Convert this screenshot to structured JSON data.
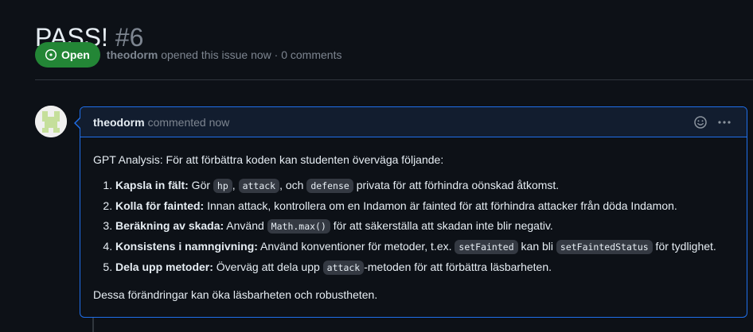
{
  "issue": {
    "title": "PASS!",
    "number": "#6",
    "state": "Open",
    "author": "theodorm",
    "opened_text": "opened this issue now · 0 comments"
  },
  "comment": {
    "author": "theodorm",
    "action": "commented now",
    "intro": "GPT Analysis: För att förbättra koden kan studenten överväga följande:",
    "items": [
      {
        "title": "Kapsla in fält:",
        "parts": [
          " Gör ",
          "hp",
          ", ",
          "attack",
          ", och ",
          "defense",
          " privata för att förhindra oönskad åtkomst."
        ]
      },
      {
        "title": "Kolla för fainted:",
        "parts": [
          " Innan attack, kontrollera om en Indamon är fainted för att förhindra attacker från döda Indamon."
        ]
      },
      {
        "title": "Beräkning av skada:",
        "parts": [
          " Använd ",
          "Math.max()",
          " för att säkerställa att skadan inte blir negativ."
        ]
      },
      {
        "title": "Konsistens i namngivning:",
        "parts": [
          " Använd konventioner för metoder, t.ex. ",
          "setFainted",
          " kan bli ",
          "setFaintedStatus",
          " för tydlighet."
        ]
      },
      {
        "title": "Dela upp metoder:",
        "parts": [
          " Överväg att dela upp ",
          "attack",
          "-metoden för att förbättra läsbarheten."
        ]
      }
    ],
    "outro": "Dessa förändringar kan öka läsbarheten och robustheten."
  },
  "icons": {
    "state": "issue-opened-icon",
    "reaction": "smiley-icon",
    "menu": "kebab-horizontal-icon"
  },
  "colors": {
    "open_badge": "#238636",
    "accent_border": "#1f6feb",
    "background": "#0d1117"
  }
}
